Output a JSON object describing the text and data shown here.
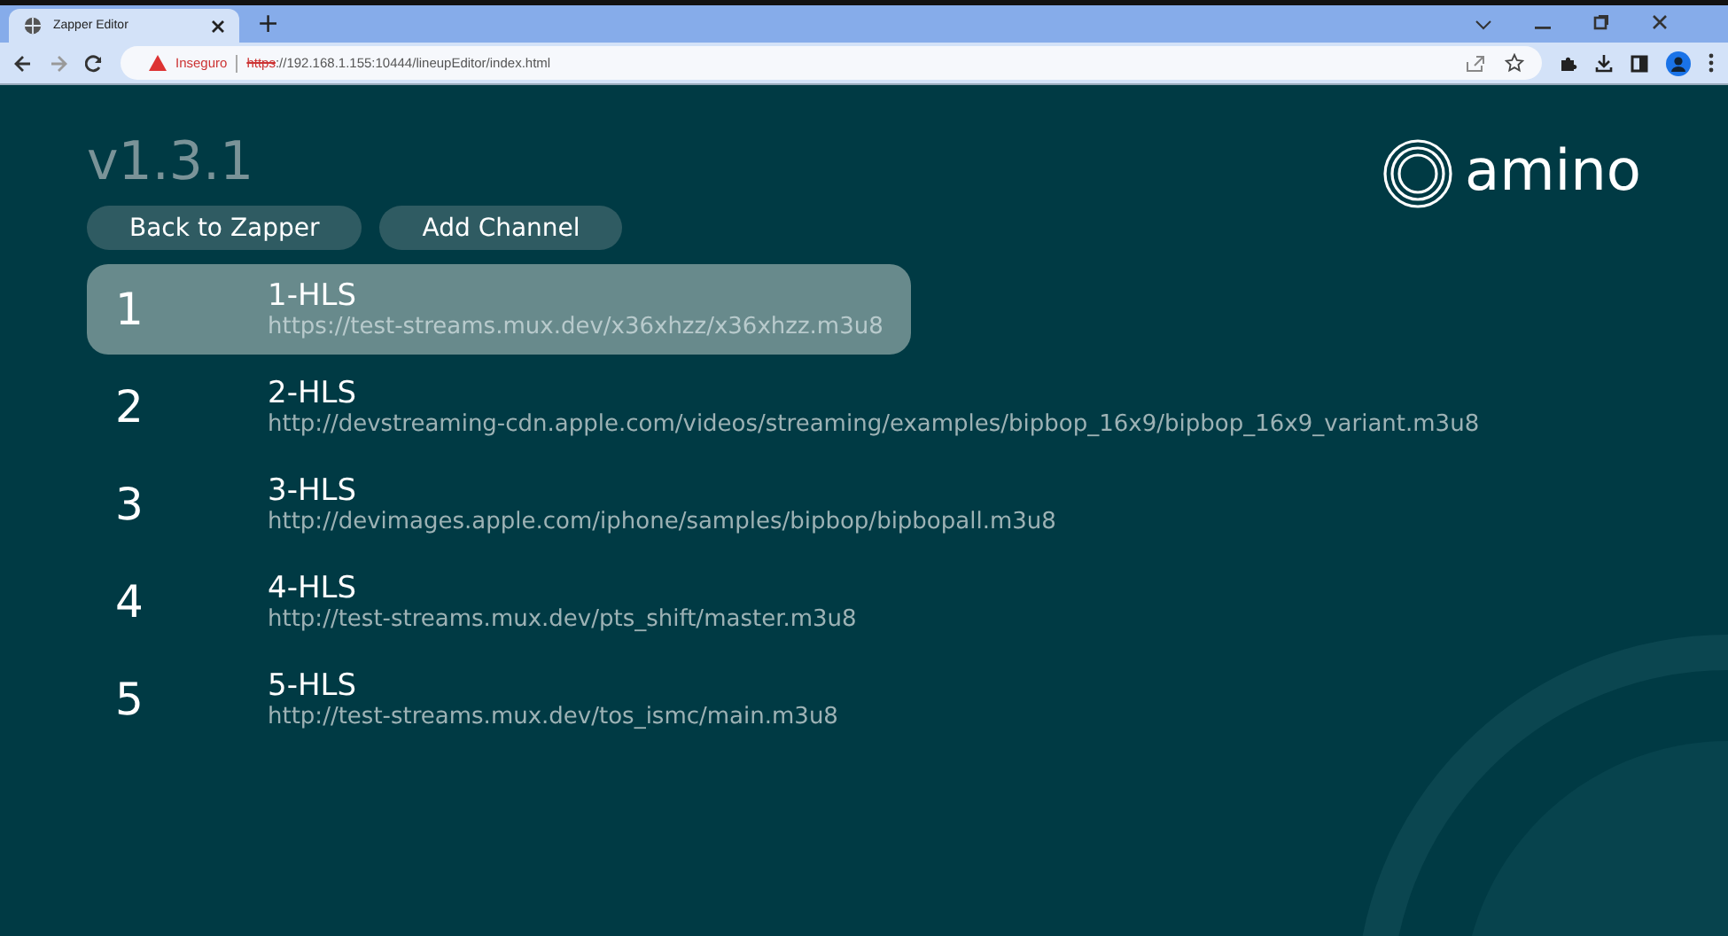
{
  "browser": {
    "tab_title": "Zapper Editor",
    "new_tab": "+",
    "security_label": "Inseguro",
    "url_scheme": "https",
    "url_rest": "://192.168.1.155:10444/lineupEditor/index.html"
  },
  "app": {
    "version": "v1.3.1",
    "logo_text": "amino",
    "buttons": [
      "Back to Zapper",
      "Add Channel"
    ]
  },
  "channels": [
    {
      "number": "1",
      "name": "1-HLS",
      "url": "https://test-streams.mux.dev/x36xhzz/x36xhzz.m3u8",
      "selected": true
    },
    {
      "number": "2",
      "name": "2-HLS",
      "url": "http://devstreaming-cdn.apple.com/videos/streaming/examples/bipbop_16x9/bipbop_16x9_variant.m3u8",
      "selected": false
    },
    {
      "number": "3",
      "name": "3-HLS",
      "url": "http://devimages.apple.com/iphone/samples/bipbop/bipbopall.m3u8",
      "selected": false
    },
    {
      "number": "4",
      "name": "4-HLS",
      "url": "http://test-streams.mux.dev/pts_shift/master.m3u8",
      "selected": false
    },
    {
      "number": "5",
      "name": "5-HLS",
      "url": "http://test-streams.mux.dev/tos_ismc/main.m3u8",
      "selected": false
    }
  ]
}
